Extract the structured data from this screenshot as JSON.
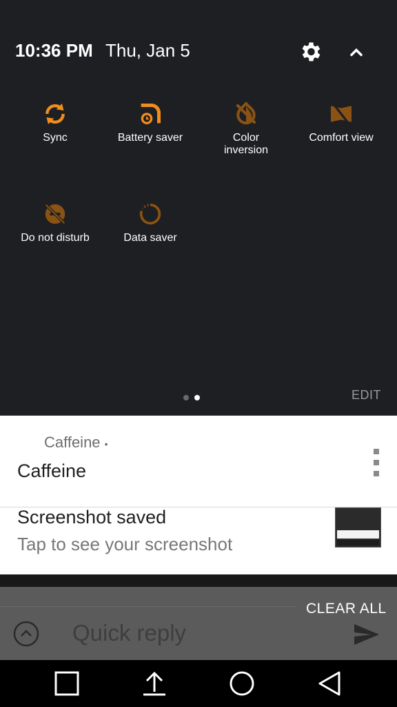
{
  "header": {
    "time": "10:36 PM",
    "date": "Thu, Jan 5",
    "settings_icon": "gear-icon",
    "collapse_icon": "chevron-up-icon"
  },
  "tiles": [
    {
      "label": "Sync",
      "icon": "sync-icon",
      "active": true
    },
    {
      "label": "Battery saver",
      "icon": "battery-saver-icon",
      "active": true
    },
    {
      "label": "Color\ninversion",
      "icon": "color-inversion-icon",
      "active": false
    },
    {
      "label": "Comfort view",
      "icon": "comfort-view-icon",
      "active": false
    },
    {
      "label": "Do not disturb",
      "icon": "do-not-disturb-icon",
      "active": false
    },
    {
      "label": "Data saver",
      "icon": "data-saver-icon",
      "active": false
    }
  ],
  "page_indicator": {
    "pages": 2,
    "current": 2
  },
  "edit_label": "EDIT",
  "notifications": [
    {
      "app": "Caffeine",
      "title": "Caffeine",
      "text": ""
    },
    {
      "app": "",
      "title": "Screenshot saved",
      "text": "Tap to see your screenshot"
    }
  ],
  "clear_all_label": "CLEAR ALL",
  "quick_reply": {
    "placeholder": "Quick reply"
  },
  "nav": [
    "recents-icon",
    "upload-icon",
    "home-icon",
    "back-icon"
  ],
  "colors": {
    "accent_active": "#f28c1c",
    "accent_inactive": "#8a5314",
    "shade_bg": "#1e1f22"
  }
}
